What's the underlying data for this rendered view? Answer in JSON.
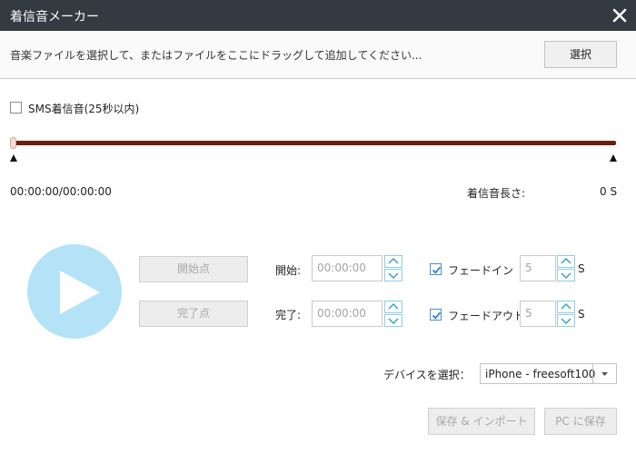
{
  "window": {
    "title": "着信音メーカー",
    "close_icon": "close-icon"
  },
  "file_bar": {
    "prompt": "音楽ファイルを選択して、またはファイルをここにドラッグして追加してください...",
    "select_button": "選択"
  },
  "sms": {
    "label": "SMS着信音(25秒以内)",
    "checked": false
  },
  "timeline": {
    "position_text": "00:00:00/00:00:00",
    "length_label": "着信音長さ:",
    "length_value": "0 S",
    "progress": 0
  },
  "controls": {
    "play_icon": "play-icon",
    "set_start_button": "開始点",
    "set_end_button": "完了点",
    "start_label": "開始:",
    "start_value": "00:00:00",
    "end_label": "完了:",
    "end_value": "00:00:00",
    "fade_in_label": "フェードイン",
    "fade_in_checked": true,
    "fade_in_value": "5",
    "fade_out_label": "フェードアウト",
    "fade_out_checked": true,
    "fade_out_value": "5",
    "seconds_unit": "S"
  },
  "device": {
    "label": "デバイスを選択：",
    "selected": "iPhone - freesoft100"
  },
  "footer": {
    "save_import_button": "保存 & インポート",
    "save_pc_button": "PC に保存"
  },
  "colors": {
    "titlebar": "#333a42",
    "track": "#6b1f0f",
    "play": "#b4e3f7",
    "accent": "#4a8fd3"
  }
}
